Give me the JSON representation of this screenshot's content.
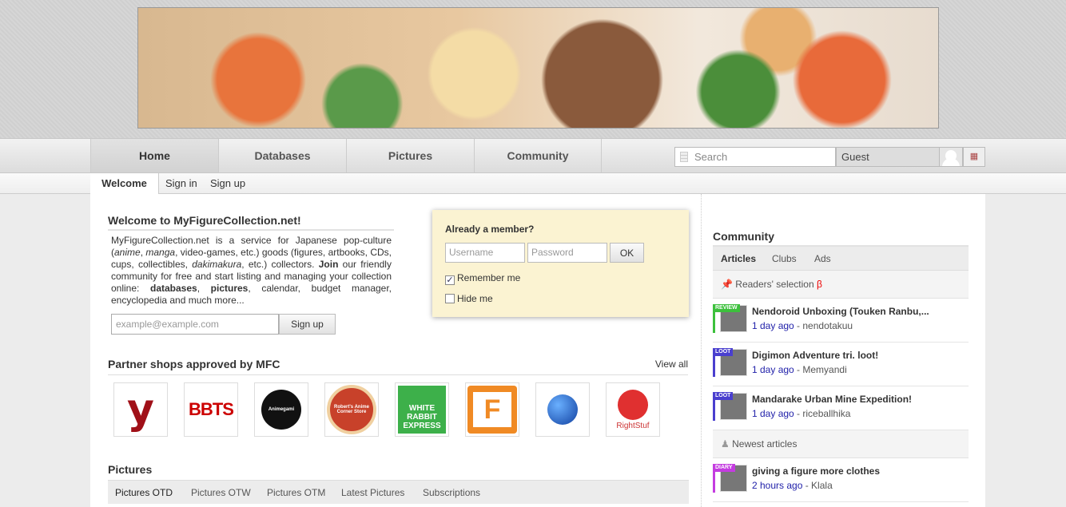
{
  "nav": {
    "tabs": [
      "Home",
      "Databases",
      "Pictures",
      "Community"
    ],
    "search_placeholder": "Search",
    "user": "Guest",
    "flag": "UK"
  },
  "subnav": [
    "Welcome",
    "Sign in",
    "Sign up"
  ],
  "welcome": {
    "title": "Welcome to MyFigureCollection.net!",
    "p1": "MyFigureCollection.net is a service for Japanese pop-culture (",
    "anime": "anime",
    "c1": ", ",
    "manga": "manga",
    "p2": ", video-games, etc.) goods (figures, artbooks, CDs, cups, collectibles, ",
    "dakimakura": "dakimakura",
    "p3": ", etc.) collectors. ",
    "join": "Join",
    "p4": " our friendly community for free and start listing and managing your collection online: ",
    "databases": "databases",
    "c2": ", ",
    "pictures": "pictures",
    "p5": ", calendar, budget manager, encyclopedia and much more...",
    "email_placeholder": "example@example.com",
    "signup": "Sign up"
  },
  "login": {
    "title": "Already a member?",
    "username_placeholder": "Username",
    "password_placeholder": "Password",
    "ok": "OK",
    "remember": "Remember me",
    "remember_checked": true,
    "hide": "Hide me",
    "hide_checked": false
  },
  "partners": {
    "title": "Partner shops approved by MFC",
    "view_all": "View all",
    "shops": [
      "y",
      "BBTS",
      "Animegami",
      "Robert's Anime Corner Store",
      "WHITE RABBIT EXPRESS",
      "F",
      "globe",
      "RightStuf"
    ]
  },
  "pictures": {
    "title": "Pictures",
    "tabs": [
      "Pictures OTD",
      "Pictures OTW",
      "Pictures OTM",
      "Latest Pictures",
      "Subscriptions"
    ]
  },
  "community": {
    "title": "Community",
    "tabs": [
      "Articles",
      "Clubs",
      "Ads"
    ],
    "readers": "Readers' selection",
    "beta": "β",
    "newest": "Newest articles",
    "articles": [
      {
        "badge": "REVIEW",
        "color": "#3cc03c",
        "title": "Nendoroid Unboxing (Touken Ranbu,...",
        "time": "1 day ago",
        "author": " - nendotakuu"
      },
      {
        "badge": "LOOT",
        "color": "#4a3fcf",
        "title": "Digimon Adventure tri. loot!",
        "time": "1 day ago",
        "author": " - Memyandi"
      },
      {
        "badge": "LOOT",
        "color": "#4a3fcf",
        "title": "Mandarake Urban Mine Expedition!",
        "time": "1 day ago",
        "author": " - riceballhika"
      }
    ],
    "newest_articles": [
      {
        "badge": "DIARY",
        "color": "#c43ce0",
        "title": "giving a figure more clothes",
        "time": "2 hours ago",
        "author": " - Klala"
      }
    ]
  }
}
